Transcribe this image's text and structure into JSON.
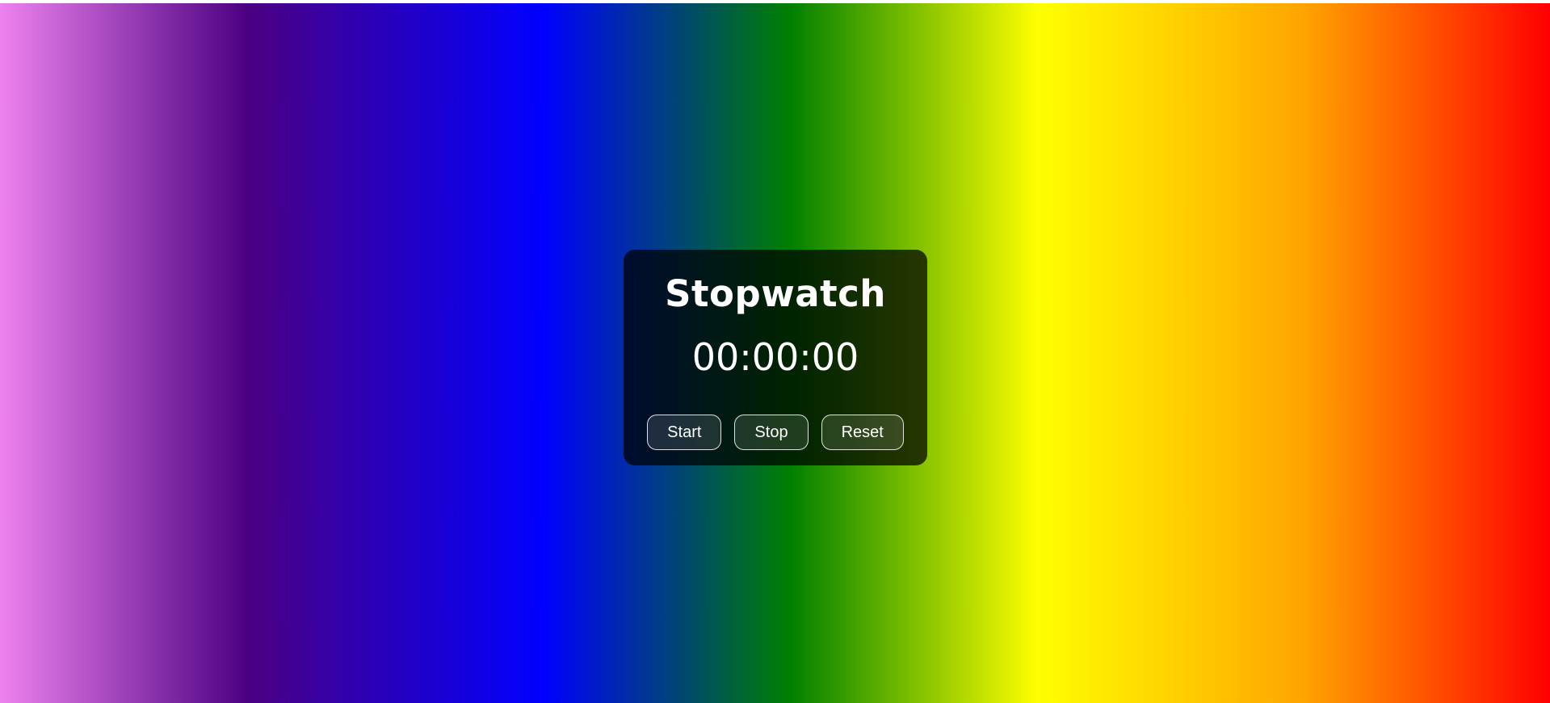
{
  "stopwatch": {
    "title": "Stopwatch",
    "display": "00:00:00",
    "buttons": {
      "start_label": "Start",
      "stop_label": "Stop",
      "reset_label": "Reset"
    }
  },
  "colors": {
    "gradient": [
      "#ee82ee",
      "#4b0082",
      "#0000ff",
      "#008000",
      "#ffff00",
      "#ffa500",
      "#ff0000"
    ],
    "card_background": "rgba(0,0,0,0.72)",
    "text": "#ffffff"
  }
}
